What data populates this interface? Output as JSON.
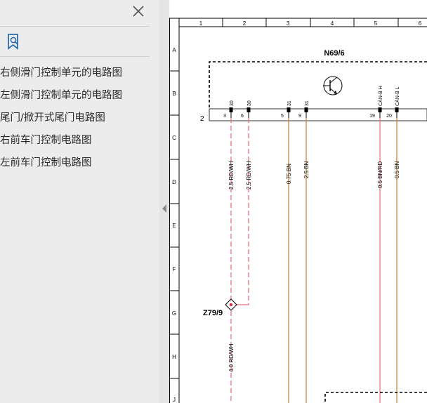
{
  "sidebar": {
    "close_icon": "close-icon",
    "bookmark_icon": "bookmark-search-icon",
    "bookmarks": [
      {
        "label": "右侧滑门控制单元的电路图"
      },
      {
        "label": "左侧滑门控制单元的电路图"
      },
      {
        "label": "尾门/掀开式尾门电路图"
      },
      {
        "label": "右前车门控制电路图"
      },
      {
        "label": "左前车门控制电路图"
      }
    ]
  },
  "splitter": {
    "collapse_icon": "collapse-left-arrow-icon"
  },
  "document": {
    "grid_columns": [
      "1",
      "2",
      "3",
      "4",
      "5",
      "6"
    ],
    "grid_rows": [
      "A",
      "B",
      "C",
      "D",
      "E",
      "F",
      "G",
      "H",
      "J"
    ],
    "component_label": "N69/6",
    "connector_number": "2",
    "splice_label": "Z79/9",
    "pin_labels_top": [
      "30",
      "30",
      "31",
      "31",
      "CAN-B H",
      "CAN-B L"
    ],
    "pin_numbers": [
      "3",
      "6",
      "5",
      "9",
      "19",
      "20"
    ],
    "wire_labels": [
      "2.5 RD/WH",
      "2.5 RD/WH",
      "0.75 BN",
      "2.5 BN",
      "0.5 BN/RD",
      "0.5 BN"
    ],
    "splice_out_wire_label": "4.0 RD/WH",
    "colors": {
      "wire_red_dashed": "#e8707a",
      "wire_brown": "#c8873a",
      "frame": "#000000",
      "sidebar_bg": "#ececec"
    }
  }
}
